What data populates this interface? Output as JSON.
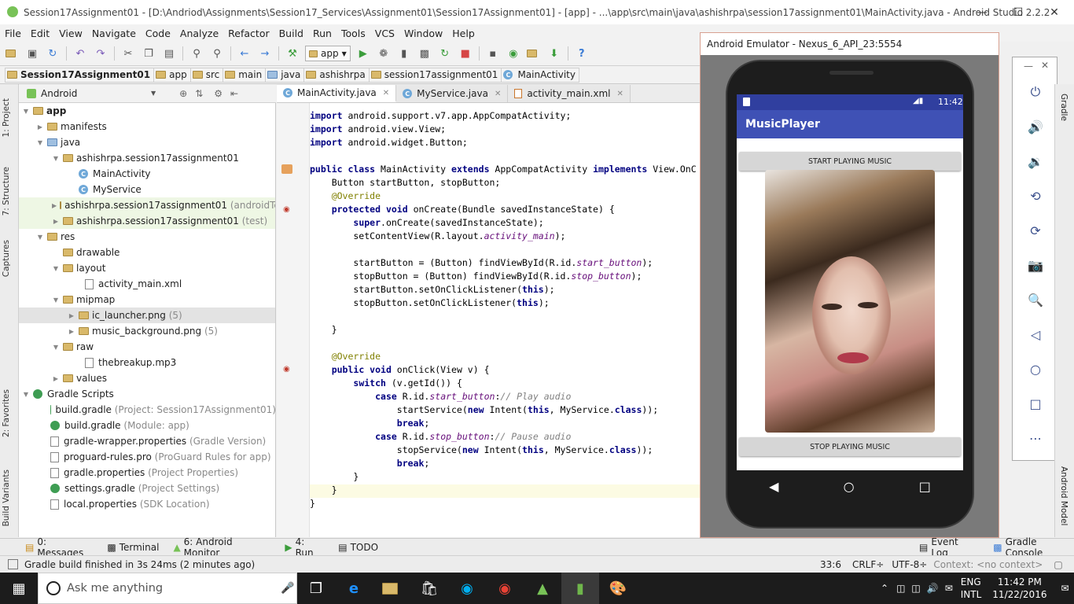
{
  "window": {
    "title": "Session17Assignment01 - [D:\\Andriod\\Assignments\\Session17_Services\\Assignment01\\Session17Assignment01] - [app] - ...\\app\\src\\main\\java\\ashishrpa\\session17assignment01\\MainActivity.java - Android Studio 2.2.2"
  },
  "menu": [
    "File",
    "Edit",
    "View",
    "Navigate",
    "Code",
    "Analyze",
    "Refactor",
    "Build",
    "Run",
    "Tools",
    "VCS",
    "Window",
    "Help"
  ],
  "toolbar": {
    "config": "app"
  },
  "breadcrumbs": [
    "Session17Assignment01",
    "app",
    "src",
    "main",
    "java",
    "ashishrpa",
    "session17assignment01",
    "MainActivity"
  ],
  "project": {
    "view": "Android",
    "tree": [
      {
        "label": "app",
        "extra": ""
      },
      {
        "label": "manifests",
        "extra": ""
      },
      {
        "label": "java",
        "extra": ""
      },
      {
        "label": "ashishrpa.session17assignment01",
        "extra": ""
      },
      {
        "label": "MainActivity",
        "extra": ""
      },
      {
        "label": "MyService",
        "extra": ""
      },
      {
        "label": "ashishrpa.session17assignment01",
        "extra": "(androidTest)"
      },
      {
        "label": "ashishrpa.session17assignment01",
        "extra": "(test)"
      },
      {
        "label": "res",
        "extra": ""
      },
      {
        "label": "drawable",
        "extra": ""
      },
      {
        "label": "layout",
        "extra": ""
      },
      {
        "label": "activity_main.xml",
        "extra": ""
      },
      {
        "label": "mipmap",
        "extra": ""
      },
      {
        "label": "ic_launcher.png",
        "extra": "(5)"
      },
      {
        "label": "music_background.png",
        "extra": "(5)"
      },
      {
        "label": "raw",
        "extra": ""
      },
      {
        "label": "thebreakup.mp3",
        "extra": ""
      },
      {
        "label": "values",
        "extra": ""
      },
      {
        "label": "Gradle Scripts",
        "extra": ""
      },
      {
        "label": "build.gradle",
        "extra": "(Project: Session17Assignment01)"
      },
      {
        "label": "build.gradle",
        "extra": "(Module: app)"
      },
      {
        "label": "gradle-wrapper.properties",
        "extra": "(Gradle Version)"
      },
      {
        "label": "proguard-rules.pro",
        "extra": "(ProGuard Rules for app)"
      },
      {
        "label": "gradle.properties",
        "extra": "(Project Properties)"
      },
      {
        "label": "settings.gradle",
        "extra": "(Project Settings)"
      },
      {
        "label": "local.properties",
        "extra": "(SDK Location)"
      }
    ]
  },
  "editor_tabs": [
    "MainActivity.java",
    "MyService.java",
    "activity_main.xml"
  ],
  "code": [
    "import android.support.v7.app.AppCompatActivity;",
    "import android.view.View;",
    "import android.widget.Button;",
    "",
    "public class MainActivity extends AppCompatActivity implements View.OnC",
    "    Button startButton, stopButton;",
    "    @Override",
    "    protected void onCreate(Bundle savedInstanceState) {",
    "        super.onCreate(savedInstanceState);",
    "        setContentView(R.layout.activity_main);",
    "",
    "        startButton = (Button) findViewById(R.id.start_button);",
    "        stopButton = (Button) findViewById(R.id.stop_button);",
    "        startButton.setOnClickListener(this);",
    "        stopButton.setOnClickListener(this);",
    "",
    "    }",
    "",
    "    @Override",
    "    public void onClick(View v) {",
    "        switch (v.getId()) {",
    "            case R.id.start_button:// Play audio",
    "                startService(new Intent(this, MyService.class));",
    "                break;",
    "            case R.id.stop_button:// Pause audio",
    "                stopService(new Intent(this, MyService.class));",
    "                break;",
    "        }",
    "    }",
    "}"
  ],
  "emulator": {
    "title": "Android Emulator - Nexus_6_API_23:5554",
    "time": "11:42",
    "app_title": "MusicPlayer",
    "start_btn": "START PLAYING MUSIC",
    "stop_btn": "STOP PLAYING MUSIC"
  },
  "left_tabs": [
    "1: Project",
    "7: Structure",
    "Captures",
    "2: Favorites",
    "Build Variants"
  ],
  "right_tabs": [
    "Gradle",
    "Android Model"
  ],
  "toolwindows": [
    "0: Messages",
    "Terminal",
    "6: Android Monitor",
    "4: Run",
    "TODO",
    "Event Log",
    "Gradle Console"
  ],
  "status": {
    "message": "Gradle build finished in 3s 24ms (2 minutes ago)",
    "pos": "33:6",
    "crlf": "CRLF÷",
    "enc": "UTF-8÷",
    "context": "Context: <no context>"
  },
  "taskbar": {
    "search": "Ask me anything",
    "lang": "ENG",
    "layout": "INTL",
    "time": "11:42 PM",
    "date": "11/22/2016"
  }
}
